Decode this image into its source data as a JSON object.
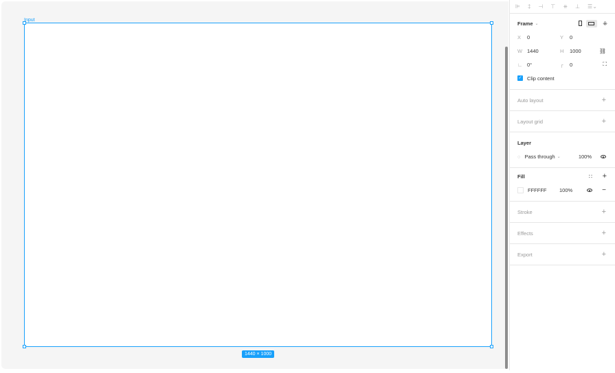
{
  "canvas": {
    "frame_label": "Input",
    "size_badge": "1440 × 1000"
  },
  "align_bar": {
    "icons": [
      "align-left-icon",
      "align-center-h-icon",
      "align-right-icon",
      "align-top-icon",
      "align-middle-v-icon",
      "align-bottom-icon",
      "distribute-icon"
    ]
  },
  "frame": {
    "title": "Frame",
    "x_label": "X",
    "x": "0",
    "y_label": "Y",
    "y": "0",
    "w_label": "W",
    "w": "1440",
    "h_label": "H",
    "h": "1000",
    "rotation": "0°",
    "radius": "0",
    "clip_label": "Clip content"
  },
  "auto_layout": {
    "title": "Auto layout"
  },
  "layout_grid": {
    "title": "Layout grid"
  },
  "layer": {
    "title": "Layer",
    "blend": "Pass through",
    "opacity": "100%"
  },
  "fill": {
    "title": "Fill",
    "hex": "FFFFFF",
    "opacity": "100%"
  },
  "stroke": {
    "title": "Stroke"
  },
  "effects": {
    "title": "Effects"
  },
  "export": {
    "title": "Export"
  },
  "colors": {
    "accent": "#18a0fb",
    "canvas_bg": "#f5f5f5"
  }
}
